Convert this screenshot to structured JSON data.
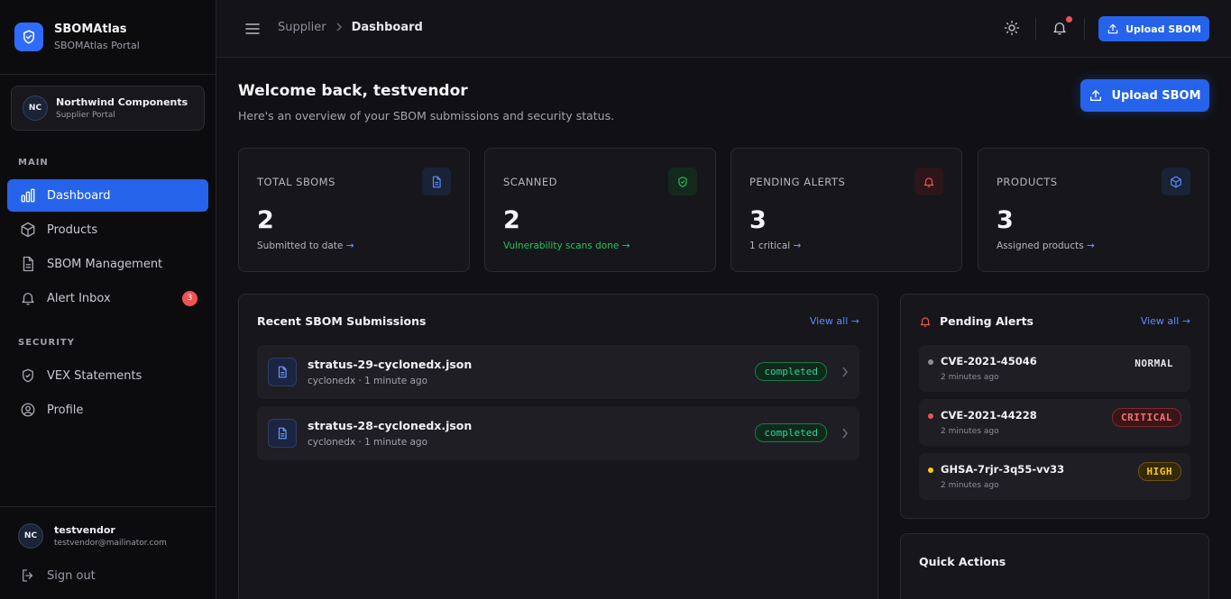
{
  "brand": {
    "name": "SBOMAtlas",
    "subtitle": "SBOMAtlas Portal"
  },
  "org": {
    "initials": "NC",
    "name": "Northwind Components",
    "subtitle": "Supplier Portal"
  },
  "sidebar": {
    "main_label": "MAIN",
    "security_label": "SECURITY",
    "items": [
      {
        "label": "Dashboard",
        "icon": "bar-chart-icon",
        "active": true
      },
      {
        "label": "Products",
        "icon": "box-icon"
      },
      {
        "label": "SBOM Management",
        "icon": "file-icon"
      },
      {
        "label": "Alert Inbox",
        "icon": "bell-icon",
        "badge": "3"
      },
      {
        "label": "VEX Statements",
        "icon": "shield-check-icon"
      },
      {
        "label": "Profile",
        "icon": "user-icon"
      }
    ]
  },
  "user": {
    "initials": "NC",
    "name": "testvendor",
    "email": "testvendor@mailinator.com",
    "signout_label": "Sign out"
  },
  "topbar": {
    "breadcrumb_parent": "Supplier",
    "breadcrumb_current": "Dashboard",
    "upload_label": "Upload SBOM"
  },
  "welcome": {
    "title": "Welcome back, testvendor",
    "subtitle": "Here's an overview of your SBOM submissions and security status.",
    "upload_label": "Upload SBOM"
  },
  "stats": [
    {
      "label": "TOTAL SBOMS",
      "value": "2",
      "sub": "Submitted to date",
      "icon": "document-icon",
      "color": "#5b8cff"
    },
    {
      "label": "SCANNED",
      "value": "2",
      "sub": "Vulnerability scans done",
      "icon": "shield-check-icon",
      "color": "#22c55e"
    },
    {
      "label": "PENDING ALERTS",
      "value": "3",
      "sub": "1 critical",
      "icon": "bell-icon",
      "color": "#f05252"
    },
    {
      "label": "PRODUCTS",
      "value": "3",
      "sub": "Assigned products",
      "icon": "cube-icon",
      "color": "#5b8cff"
    }
  ],
  "arrow": "→",
  "recent": {
    "title": "Recent SBOM Submissions",
    "view_all": "View all →",
    "rows": [
      {
        "name": "stratus-29-cyclonedx.json",
        "meta": "cyclonedx · 1 minute ago",
        "status": "completed"
      },
      {
        "name": "stratus-28-cyclonedx.json",
        "meta": "cyclonedx · 1 minute ago",
        "status": "completed"
      }
    ]
  },
  "alerts": {
    "title": "Pending Alerts",
    "view_all": "View all →",
    "rows": [
      {
        "id": "CVE-2021-45046",
        "time": "2 minutes ago",
        "severity": "NORMAL",
        "dot": "#8e8e99"
      },
      {
        "id": "CVE-2021-44228",
        "time": "2 minutes ago",
        "severity": "CRITICAL",
        "dot": "#f05252"
      },
      {
        "id": "GHSA-7rjr-3q55-vv33",
        "time": "2 minutes ago",
        "severity": "HIGH",
        "dot": "#facc15"
      }
    ]
  },
  "quick_actions": {
    "title": "Quick Actions"
  },
  "colors": {
    "accent": "#2563eb",
    "success": "#22c55e",
    "danger": "#f05252",
    "warning": "#facc15"
  }
}
